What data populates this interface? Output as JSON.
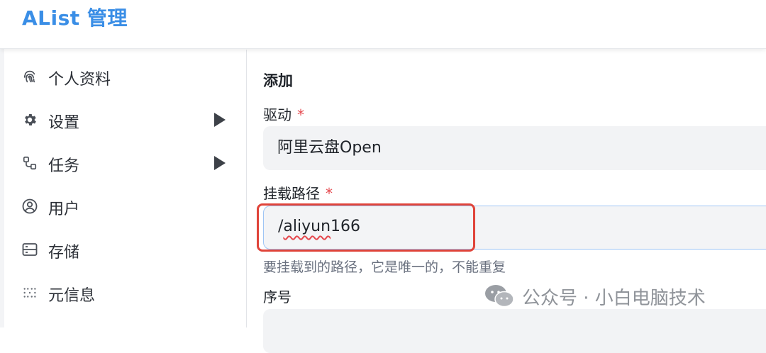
{
  "header": {
    "title": "AList 管理"
  },
  "sidebar": {
    "items": [
      {
        "label": "个人资料",
        "icon": "fingerprint-icon",
        "has_arrow": false
      },
      {
        "label": "设置",
        "icon": "gear-icon",
        "has_arrow": true
      },
      {
        "label": "任务",
        "icon": "workflow-icon",
        "has_arrow": true
      },
      {
        "label": "用户",
        "icon": "user-circle-icon",
        "has_arrow": false
      },
      {
        "label": "存储",
        "icon": "storage-icon",
        "has_arrow": false
      },
      {
        "label": "元信息",
        "icon": "dots-grid-icon",
        "has_arrow": false
      }
    ]
  },
  "form": {
    "section_title": "添加",
    "driver": {
      "label": "驱动",
      "required_mark": "*",
      "value": "阿里云盘Open"
    },
    "mount_path": {
      "label": "挂载路径",
      "required_mark": "*",
      "value_prefix": "/",
      "value_misspelled": "aliyun",
      "value_suffix": "166",
      "hint": "要挂载到的路径，它是唯一的，不能重复"
    },
    "order": {
      "label": "序号"
    }
  },
  "watermark": {
    "text": "公众号 · 小白电脑技术"
  },
  "colors": {
    "accent": "#3a8ee6",
    "required": "#e5484d",
    "highlight_box": "#e0443a"
  }
}
